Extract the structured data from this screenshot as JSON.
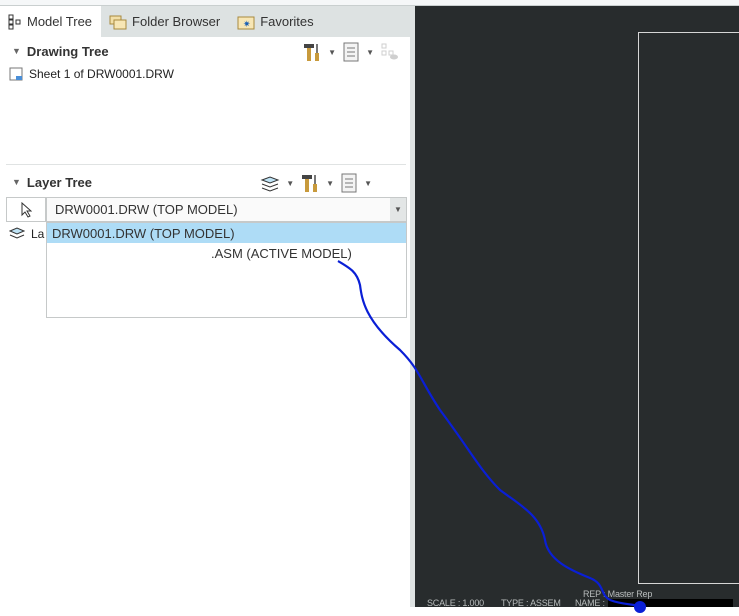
{
  "tabs": [
    {
      "label": "Model Tree",
      "icon": "model-tree-icon"
    },
    {
      "label": "Folder Browser",
      "icon": "folder-icon"
    },
    {
      "label": "Favorites",
      "icon": "favorites-icon"
    }
  ],
  "drawing_tree": {
    "title": "Drawing Tree",
    "items": [
      "Sheet 1 of DRW0001.DRW"
    ]
  },
  "layer_tree": {
    "title": "Layer Tree",
    "partial_item": "La",
    "combo_value": "DRW0001.DRW (TOP MODEL)",
    "options": [
      "DRW0001.DRW (TOP MODEL)",
      ".ASM (ACTIVE MODEL)"
    ]
  },
  "status": {
    "scale": "SCALE : 1.000",
    "type": "TYPE : ASSEM",
    "name": "NAME :",
    "rep": "REP : Master Rep"
  },
  "colors": {
    "canvas": "#282c2d",
    "selection": "#aedcf6",
    "annotation": "#0a1fd6"
  }
}
